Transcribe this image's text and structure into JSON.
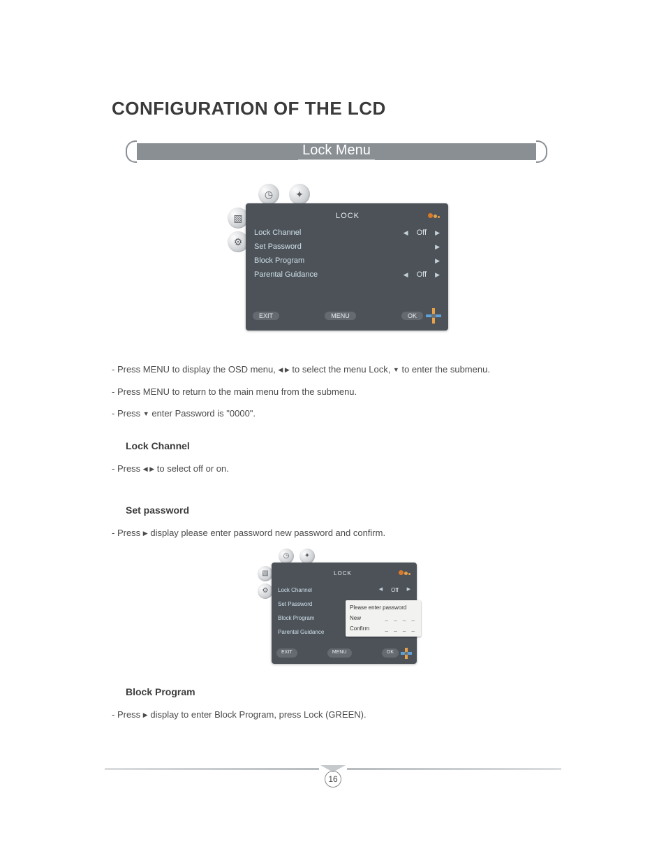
{
  "title": "CONFIGURATION OF THE LCD",
  "pill": {
    "label": "Lock Menu"
  },
  "osd": {
    "header_title": "LOCK",
    "rows": [
      {
        "label": "Lock Channel",
        "value": "Off",
        "has_left": true,
        "has_right": true
      },
      {
        "label": "Set Password",
        "value": "",
        "has_left": false,
        "has_right": true
      },
      {
        "label": "Block Program",
        "value": "",
        "has_left": false,
        "has_right": true
      },
      {
        "label": "Parental Guidance",
        "value": "Off",
        "has_left": true,
        "has_right": true
      }
    ],
    "footer": {
      "exit": "EXIT",
      "menu": "MENU",
      "ok": "OK"
    }
  },
  "osd_small": {
    "header_title": "LOCK",
    "rows": [
      {
        "label": "Lock Channel",
        "value": "Off"
      },
      {
        "label": "Set Password",
        "value": ""
      },
      {
        "label": "Block Program",
        "value": ""
      },
      {
        "label": "Parental Guidance",
        "value": ""
      }
    ],
    "footer": {
      "exit": "EXIT",
      "menu": "MENU",
      "ok": "OK"
    },
    "popup": {
      "title": "Please enter password",
      "row1_label": "New",
      "row2_label": "Confirm",
      "dashes": "_ _ _ _"
    }
  },
  "instructions": {
    "line1_a": "- Press MENU to display the OSD menu, ",
    "line1_b": " to select the menu Lock, ",
    "line1_c": " to enter the submenu.",
    "line2": "- Press MENU to return to the main menu from the submenu.",
    "line3_a": "- Press ",
    "line3_b": " enter Password is \"0000\".",
    "lock_channel_h": "Lock Channel",
    "lock_channel_a": "- Press ",
    "lock_channel_b": " to select off or on.",
    "set_pw_h": "Set password",
    "set_pw_a": "- Press ",
    "set_pw_b": " display please enter password new password and confirm.",
    "block_h": "Block Program",
    "block_a": "- Press ",
    "block_b": " display to enter Block Program, press Lock (GREEN)."
  },
  "glyphs": {
    "left": "◀",
    "right": "▶",
    "down": "▼",
    "leftright": "◀ ▶"
  },
  "page_number": "16"
}
